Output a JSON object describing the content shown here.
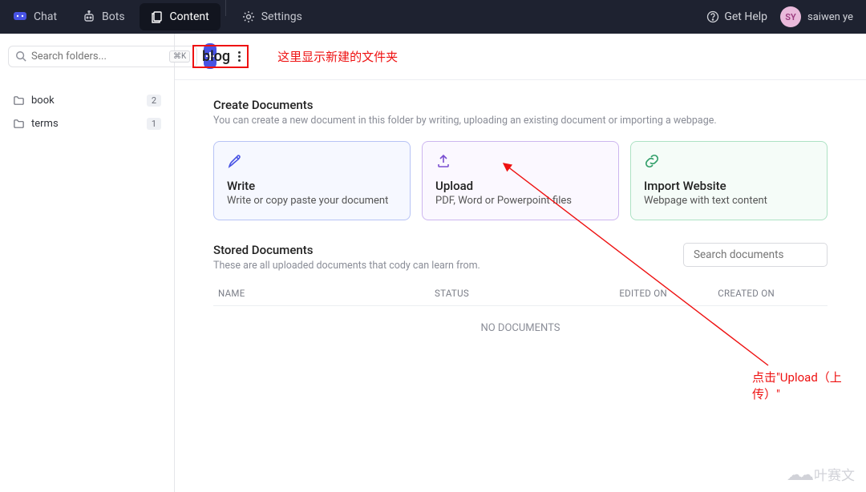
{
  "topbar": {
    "nav": {
      "chat": "Chat",
      "bots": "Bots",
      "content": "Content",
      "settings": "Settings"
    },
    "help": "Get Help",
    "user": {
      "initials": "SY",
      "name": "saiwen ye"
    }
  },
  "sidebar": {
    "search_placeholder": "Search folders...",
    "shortcut": "⌘K",
    "folders": [
      {
        "name": "book",
        "count": "2"
      },
      {
        "name": "terms",
        "count": "1"
      }
    ]
  },
  "header": {
    "folder_name": "blog"
  },
  "create": {
    "title": "Create Documents",
    "subtitle": "You can create a new document in this folder by writing, uploading an existing document or importing a webpage.",
    "write": {
      "title": "Write",
      "desc": "Write or copy paste your document"
    },
    "upload": {
      "title": "Upload",
      "desc": "PDF, Word or Powerpoint files"
    },
    "import": {
      "title": "Import Website",
      "desc": "Webpage with text content"
    }
  },
  "stored": {
    "title": "Stored Documents",
    "subtitle": "These are all uploaded documents that cody can learn from.",
    "search_placeholder": "Search documents",
    "cols": {
      "name": "NAME",
      "status": "STATUS",
      "edited": "EDITED ON",
      "created": "CREATED ON"
    },
    "empty": "NO DOCUMENTS"
  },
  "annotations": {
    "a1": "这里显示新建的文件夹",
    "a2": "点击\"Upload（上传）\""
  },
  "watermark": "叶赛文"
}
